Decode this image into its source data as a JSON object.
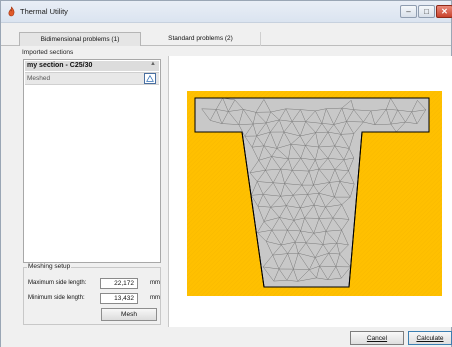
{
  "window": {
    "title": "Thermal Utility",
    "icon": "app-flame-icon",
    "controls": {
      "minimize": "–",
      "maximize": "□",
      "close": "✕"
    }
  },
  "tabs": [
    {
      "label": "Bidimensional problems (1)",
      "active": true
    },
    {
      "label": "Standard problems (2)",
      "active": false
    }
  ],
  "imported_sections": {
    "group_label": "Imported sections",
    "items": [
      {
        "name": "my section - C25/30",
        "status": "Meshed"
      }
    ]
  },
  "meshing_setup": {
    "group_label": "Meshing setup",
    "max_side": {
      "label": "Maximum side length:",
      "value": "22,172",
      "unit": "mm"
    },
    "min_side": {
      "label": "Minimum side length:",
      "value": "13,432",
      "unit": "mm"
    },
    "mesh_button": "Mesh"
  },
  "footer": {
    "cancel": "Cancel",
    "calculate": "Calculate"
  },
  "colors": {
    "background_fill": "#FFC000",
    "section_fill": "#C8C8C8",
    "mesh_lines": "#7A7A7A",
    "outline": "#000000"
  }
}
